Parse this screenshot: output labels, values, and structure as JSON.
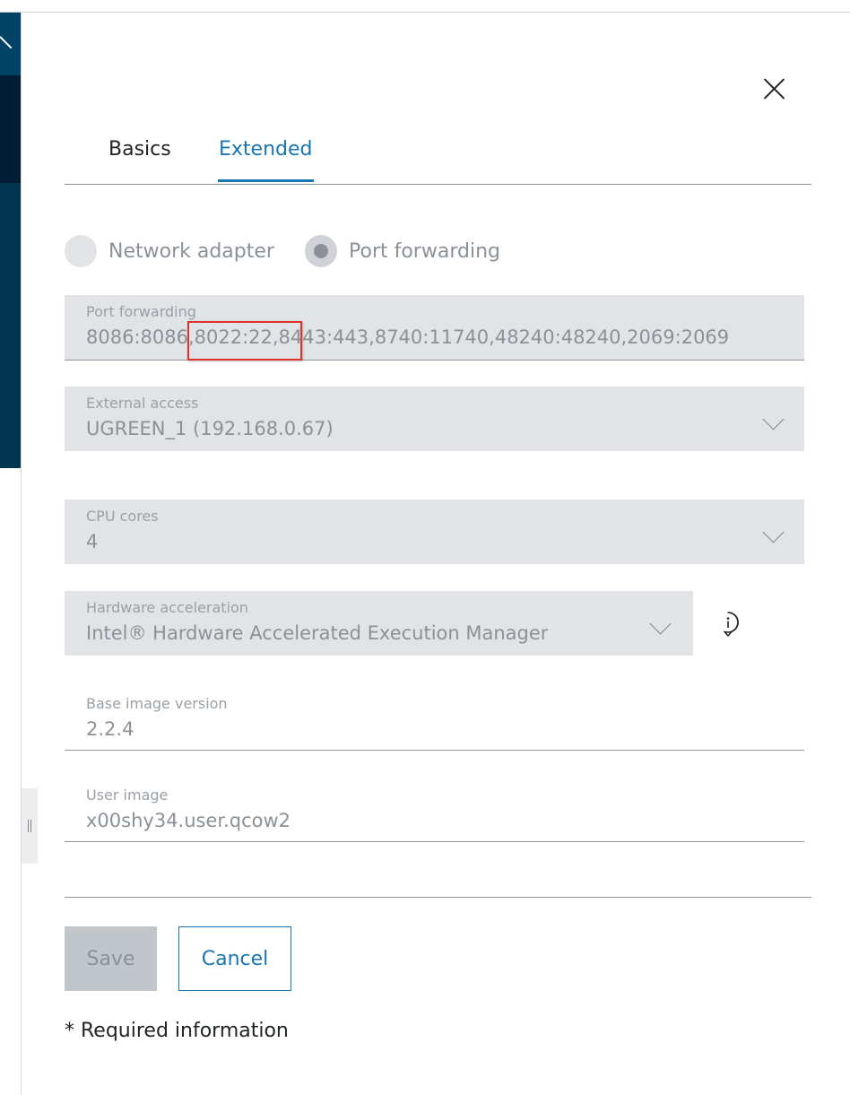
{
  "dialog": {
    "tabs": [
      {
        "label": "Basics",
        "active": false
      },
      {
        "label": "Extended",
        "active": true
      }
    ],
    "close_icon": "close-icon"
  },
  "network_mode": {
    "options": [
      {
        "label": "Network adapter",
        "checked": false
      },
      {
        "label": "Port forwarding",
        "checked": true
      }
    ]
  },
  "fields": {
    "port_forwarding": {
      "label": "Port forwarding",
      "value": "8086:8086,8022:22,8443:443,8740:11740,48240:48240,2069:2069"
    },
    "external_access": {
      "label": "External access",
      "value": "UGREEN_1 (192.168.0.67)"
    },
    "cpu_cores": {
      "label": "CPU cores",
      "value": "4"
    },
    "hardware_acceleration": {
      "label": "Hardware acceleration",
      "value": "Intel® Hardware Accelerated Execution Manager",
      "info_icon": "info-icon"
    },
    "base_image_version": {
      "label": "Base image version",
      "value": "2.2.4"
    },
    "user_image": {
      "label": "User image",
      "value": "x00shy34.user.qcow2"
    }
  },
  "actions": {
    "save_label": "Save",
    "cancel_label": "Cancel"
  },
  "required_note": "* Required information",
  "colors": {
    "accent": "#1976b4",
    "nav_dark": "#00344f",
    "highlight": "#e0312b",
    "field_bg": "#e1e3e6"
  }
}
